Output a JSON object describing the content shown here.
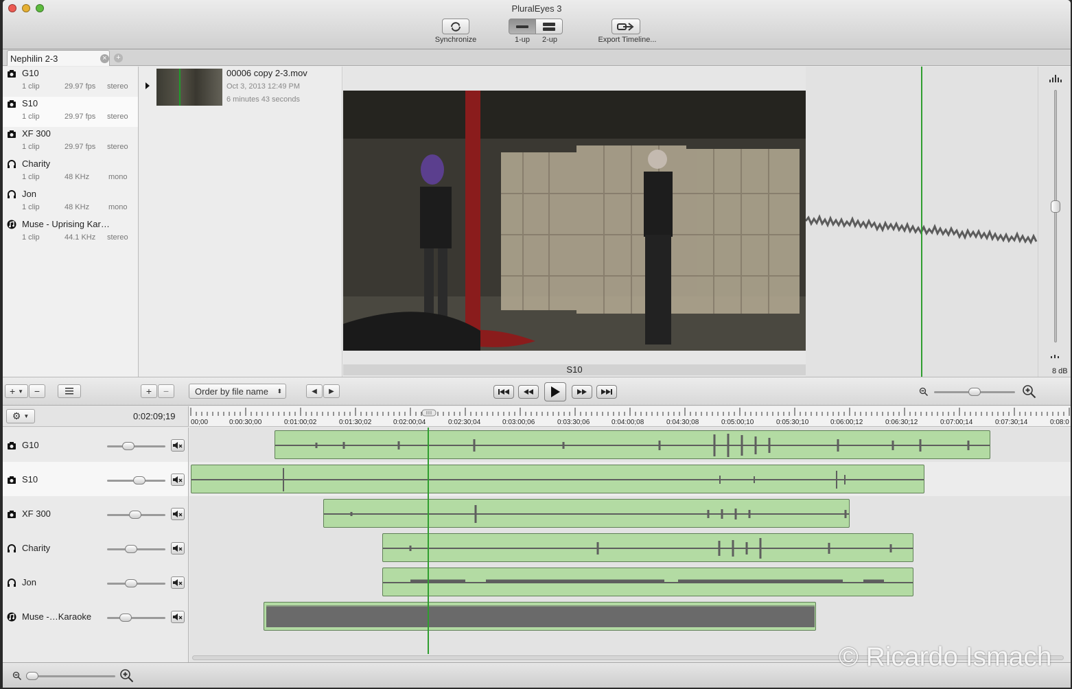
{
  "window": {
    "title": "PluralEyes 3"
  },
  "toolbar": {
    "synchronize": "Synchronize",
    "one_up": "1-up",
    "two_up": "2-up",
    "export": "Export Timeline..."
  },
  "tab": {
    "label": "Nephilin 2-3"
  },
  "media": [
    {
      "name": "G10",
      "icon": "camera-icon",
      "clips": "1 clip",
      "rate": "29.97 fps",
      "channels": "stereo"
    },
    {
      "name": "S10",
      "icon": "camera-icon",
      "clips": "1 clip",
      "rate": "29.97 fps",
      "channels": "stereo"
    },
    {
      "name": "XF 300",
      "icon": "camera-icon",
      "clips": "1 clip",
      "rate": "29.97 fps",
      "channels": "stereo"
    },
    {
      "name": "Charity",
      "icon": "headphones-icon",
      "clips": "1 clip",
      "rate": "48 KHz",
      "channels": "mono"
    },
    {
      "name": "Jon",
      "icon": "headphones-icon",
      "clips": "1 clip",
      "rate": "48 KHz",
      "channels": "mono"
    },
    {
      "name": "Muse - Uprising Kar…",
      "icon": "music-icon",
      "clips": "1 clip",
      "rate": "44.1 KHz",
      "channels": "stereo"
    }
  ],
  "clip": {
    "filename": "00006 copy 2-3.mov",
    "date": "Oct 3, 2013 12:49 PM",
    "duration": "6 minutes 43 seconds"
  },
  "viewer": {
    "label": "S10"
  },
  "meter": {
    "db": "8 dB"
  },
  "controls": {
    "order": "Order by file name",
    "add": "+",
    "remove": "−"
  },
  "timeline": {
    "timecode": "0:02:09;19",
    "ruler": [
      "00;00",
      "0:00:30;00",
      "0:01:00;02",
      "0:01:30;02",
      "0:02:00;04",
      "0:02:30;04",
      "0:03:00;06",
      "0:03:30;06",
      "0:04:00;08",
      "0:04:30;08",
      "0:05:00;10",
      "0:05:30;10",
      "0:06:00;12",
      "0:06:30;12",
      "0:07:00;14",
      "0:07:30;14",
      "0:08:0"
    ],
    "tracks": [
      {
        "name": "G10",
        "icon": "camera-icon",
        "volume": 0.36
      },
      {
        "name": "S10",
        "icon": "camera-icon",
        "volume": 0.55
      },
      {
        "name": "XF 300",
        "icon": "camera-icon",
        "volume": 0.47
      },
      {
        "name": "Charity",
        "icon": "headphones-icon",
        "volume": 0.42
      },
      {
        "name": "Jon",
        "icon": "headphones-icon",
        "volume": 0.42
      },
      {
        "name": "Muse -…Karaoke",
        "icon": "music-icon",
        "volume": 0.32
      }
    ],
    "accent": "#2f9e2f",
    "clip_color": "#b3dba3"
  },
  "watermark": "© Ricardo Ismach"
}
